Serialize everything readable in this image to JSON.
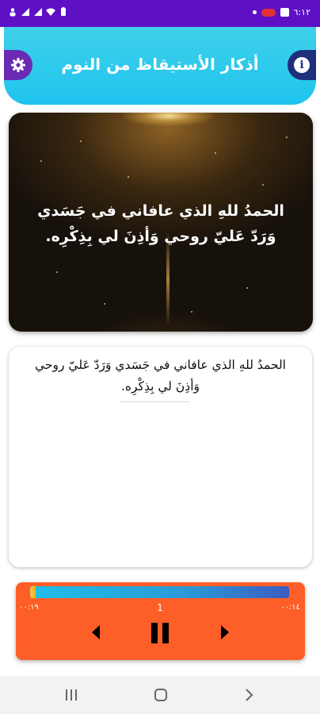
{
  "status_bar": {
    "time": "٦:١٢",
    "icons": [
      "battery-icon",
      "wifi-icon",
      "signal-icon",
      "signal-icon",
      "person-icon",
      "notification-dot",
      "app-badge-icon",
      "image-icon"
    ]
  },
  "header": {
    "title": "أذكار الأستيقاظ من النوم",
    "left_button_icon": "gear-icon",
    "right_button_icon": "info-icon",
    "colors": {
      "background": "#25c8ee",
      "left_button": "#6a2bb4",
      "right_button": "#1f2f7c"
    }
  },
  "image_card": {
    "text": "الحمدُ للهِ الذي عافاني في جَسَدي وَرَدّ عَليّ روحي وَأذِنَ لي بِذِكْرِه."
  },
  "text_card": {
    "text": "الحمدُ للهِ الذي عافاني في جَسَدي وَرَدّ عَليّ روحي وَأذِنَ لي بِذِكْرِه."
  },
  "player": {
    "time_left": "٠٠:١٩",
    "time_right": "٠٠:١٤",
    "ayah_number": "1",
    "progress": 0.015,
    "colors": {
      "background": "#fe5e27",
      "track_start": "#1fbfe8",
      "track_end": "#3b5cc0"
    }
  },
  "nav_bar": {
    "icons": [
      "recents-icon",
      "home-icon",
      "back-icon"
    ]
  }
}
